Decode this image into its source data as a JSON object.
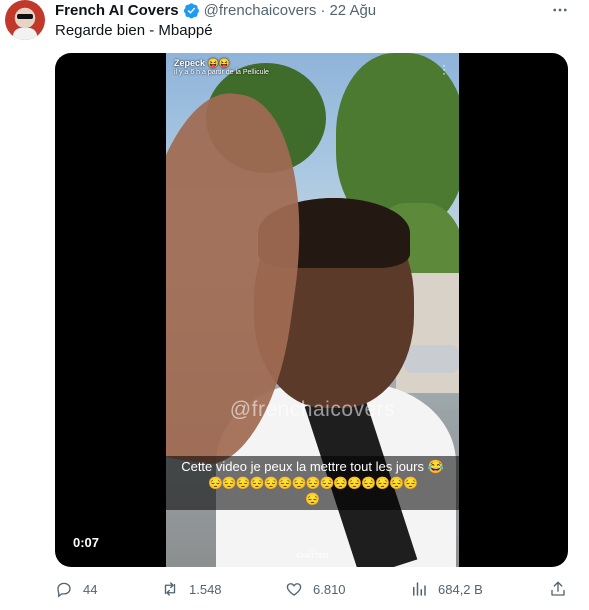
{
  "tweet": {
    "author_name": "French AI Covers",
    "handle": "@frenchaicovers",
    "separator": "·",
    "date": "22 Ağu",
    "text": "Regarde bien - Mbappé",
    "verified": true
  },
  "video": {
    "snap_user": "Zepeck 😝😝",
    "snap_subtitle": "il y a 6 h à partir de la Pellicule",
    "watermark": "@frenchaicovers",
    "caption_line1": "Cette video je peux la mettre tout les jours 😂",
    "caption_line2": "😔😔😔😔😔😔😔😔😔😔😔😔😔😔😔",
    "caption_line3": "😔",
    "chatter_label": "CHATTER",
    "timestamp": "0:07"
  },
  "actions": {
    "replies": "44",
    "retweets": "1.548",
    "likes": "6.810",
    "views": "684,2 B"
  },
  "icons": {
    "verified": "verified-badge-icon",
    "more": "more-options-icon",
    "reply": "reply-icon",
    "retweet": "retweet-icon",
    "like": "heart-icon",
    "views": "views-chart-icon",
    "share": "share-icon"
  },
  "colors": {
    "text_primary": "#0f1419",
    "text_secondary": "#536471",
    "verified_blue": "#1d9bf0",
    "media_background": "#000000"
  }
}
